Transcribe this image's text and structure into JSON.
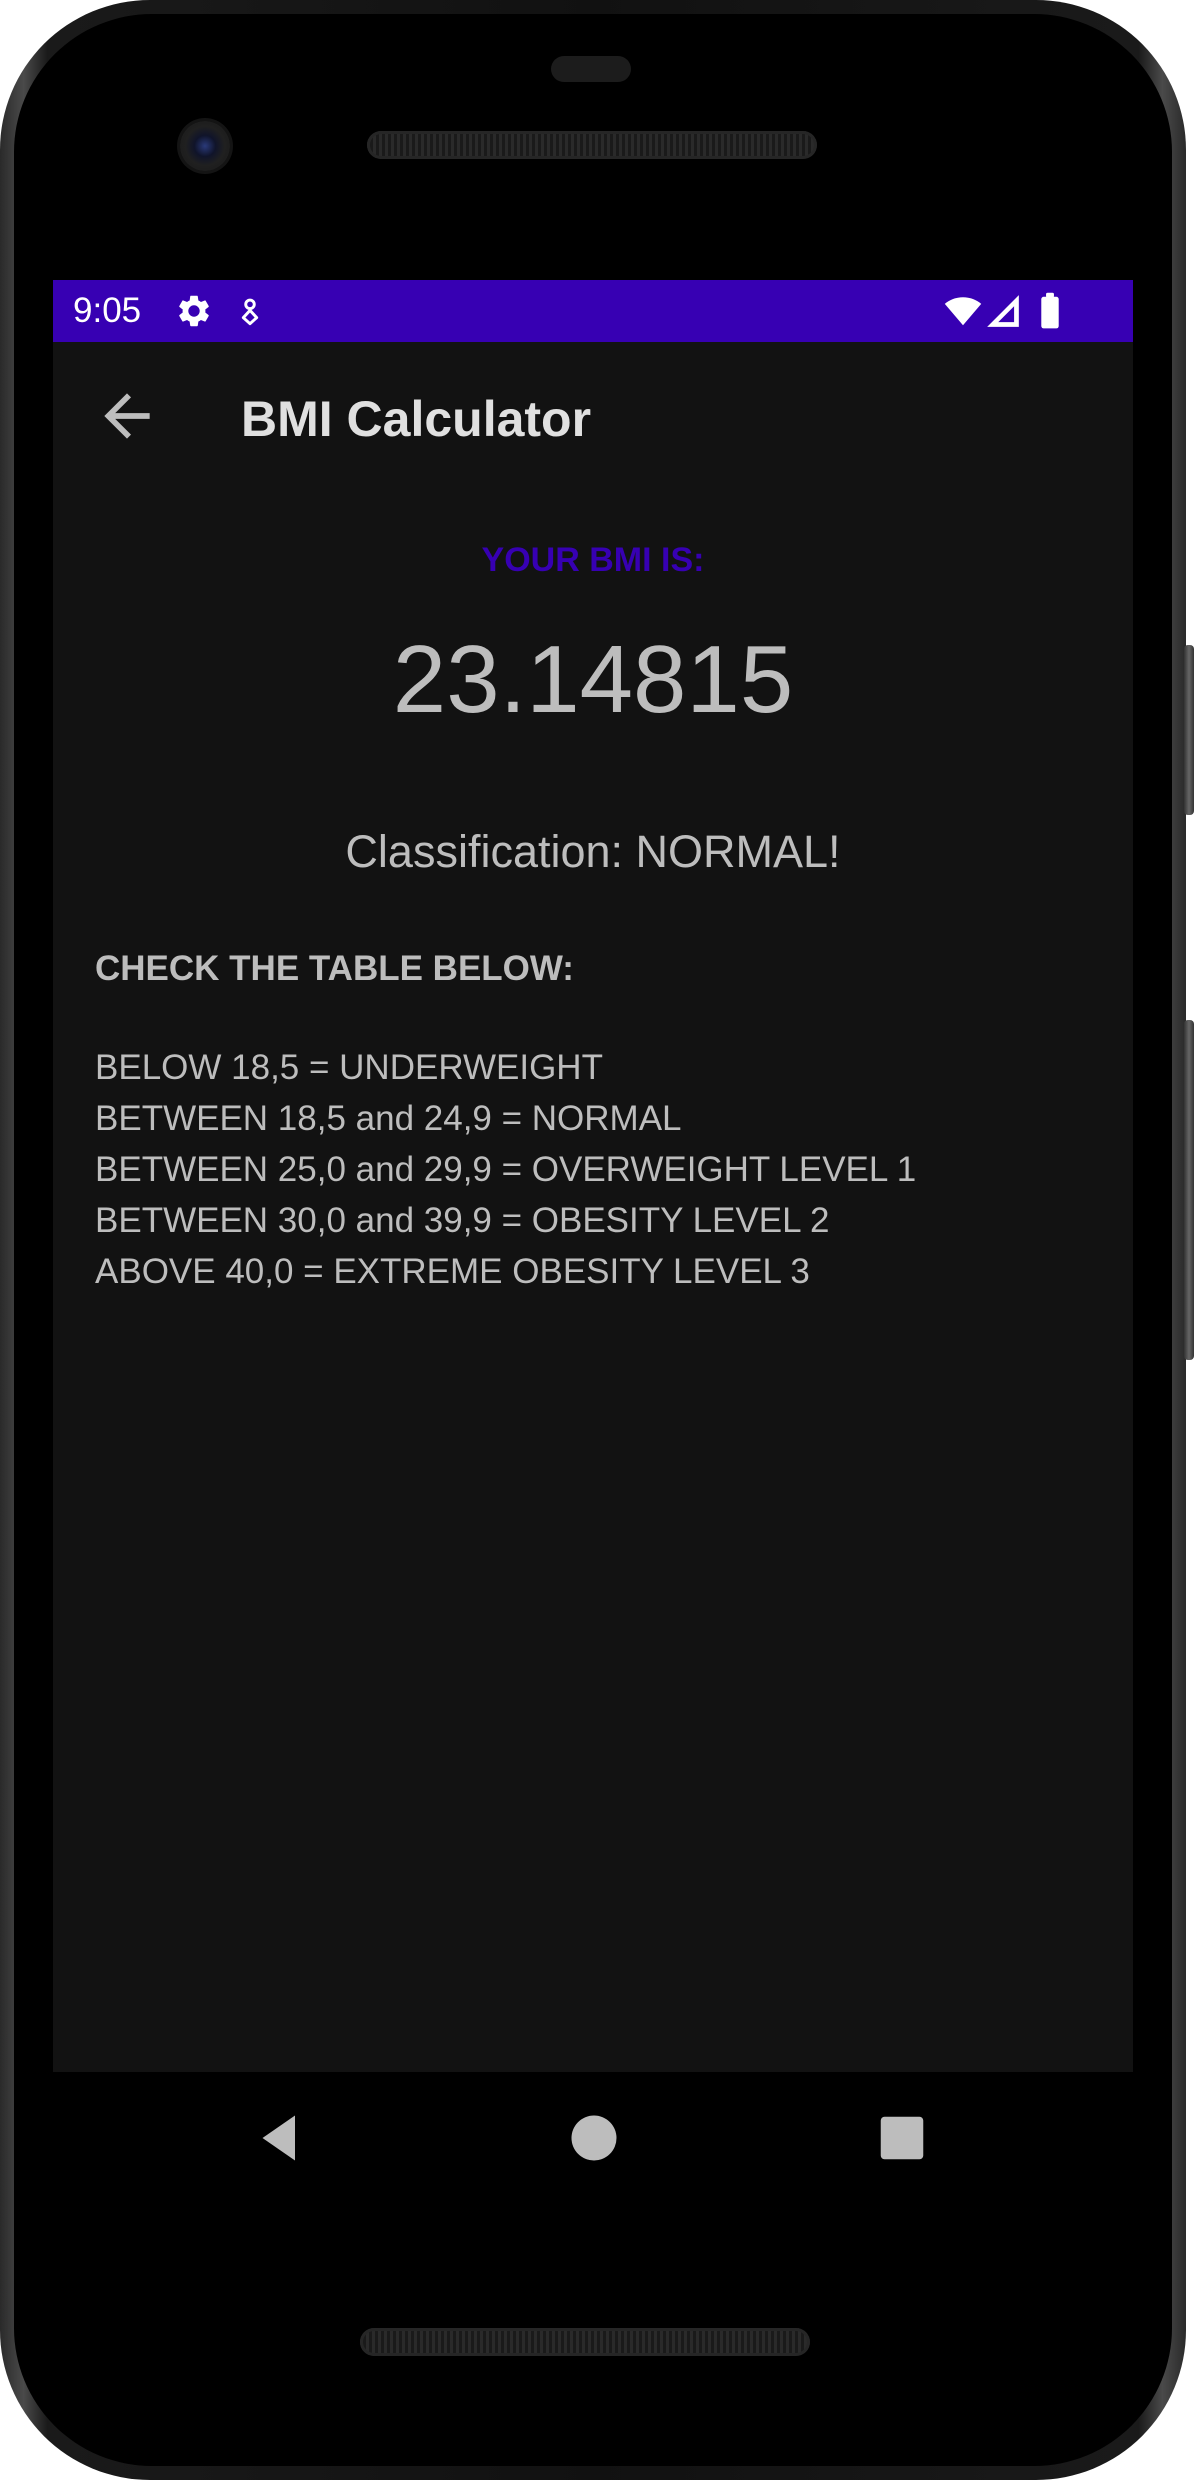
{
  "status_bar": {
    "time": "9:05",
    "background_color": "#3700b3",
    "left_icons": [
      "gear-icon",
      "location-pin-icon"
    ],
    "right_icons": [
      "wifi-icon",
      "signal-icon",
      "battery-icon"
    ]
  },
  "app_bar": {
    "back_icon": "arrow-back-icon",
    "title": "BMI Calculator"
  },
  "result": {
    "label": "YOUR BMI IS:",
    "label_color": "#3700b3",
    "value": "23.14815",
    "classification": "Classification: NORMAL!"
  },
  "reference_table": {
    "heading": "CHECK THE TABLE BELOW:",
    "lines": [
      "BELOW 18,5 = UNDERWEIGHT",
      "BETWEEN 18,5 and 24,9 = NORMAL",
      "BETWEEN 25,0 and 29,9 = OVERWEIGHT LEVEL 1",
      "BETWEEN 30,0 and 39,9 = OBESITY LEVEL 2",
      "ABOVE 40,0 = EXTREME OBESITY LEVEL 3"
    ]
  },
  "navigation_bar": {
    "buttons": [
      "nav-back-icon",
      "nav-home-icon",
      "nav-recents-icon"
    ]
  }
}
